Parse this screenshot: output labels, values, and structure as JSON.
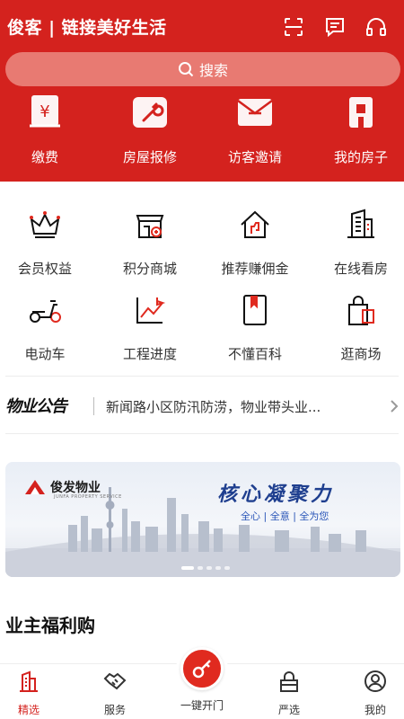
{
  "header": {
    "brand": "俊客 | 链接美好生活",
    "icons": [
      "scan-icon",
      "message-icon",
      "headset-icon"
    ],
    "search_placeholder": "搜索",
    "quick_actions": [
      {
        "label": "缴费",
        "icon": "payment-icon"
      },
      {
        "label": "房屋报修",
        "icon": "repair-icon"
      },
      {
        "label": "访客邀请",
        "icon": "visitor-invite-icon"
      },
      {
        "label": "我的房子",
        "icon": "my-house-icon"
      }
    ]
  },
  "services": [
    {
      "label": "会员权益",
      "icon": "crown-icon"
    },
    {
      "label": "积分商城",
      "icon": "points-store-icon"
    },
    {
      "label": "推荐赚佣金",
      "icon": "recommend-house-icon"
    },
    {
      "label": "在线看房",
      "icon": "building-icon"
    },
    {
      "label": "电动车",
      "icon": "scooter-icon"
    },
    {
      "label": "工程进度",
      "icon": "progress-chart-icon"
    },
    {
      "label": "不懂百科",
      "icon": "book-icon"
    },
    {
      "label": "逛商场",
      "icon": "shopping-bag-icon"
    }
  ],
  "notice": {
    "title": "物业公告",
    "text": "新闻路小区防汛防涝，物业带头业..."
  },
  "banner": {
    "logo_text": "俊发物业",
    "logo_sub": "JUNFA PROPERTY SERVICE",
    "slogan": "核心凝聚力",
    "slogan_sub": "全心 | 全意 | 全为您"
  },
  "section_title": "业主福利购",
  "tabbar": {
    "tabs": [
      {
        "label": "精选",
        "icon": "home-featured-icon",
        "active": true
      },
      {
        "label": "服务",
        "icon": "handshake-icon",
        "active": false
      },
      {
        "label": "一键开门",
        "icon": "key-icon",
        "active": false
      },
      {
        "label": "严选",
        "icon": "gift-box-icon",
        "active": false
      },
      {
        "label": "我的",
        "icon": "user-icon",
        "active": false
      }
    ]
  },
  "colors": {
    "brand_red": "#d4221e",
    "search_bg": "#e87a72"
  }
}
